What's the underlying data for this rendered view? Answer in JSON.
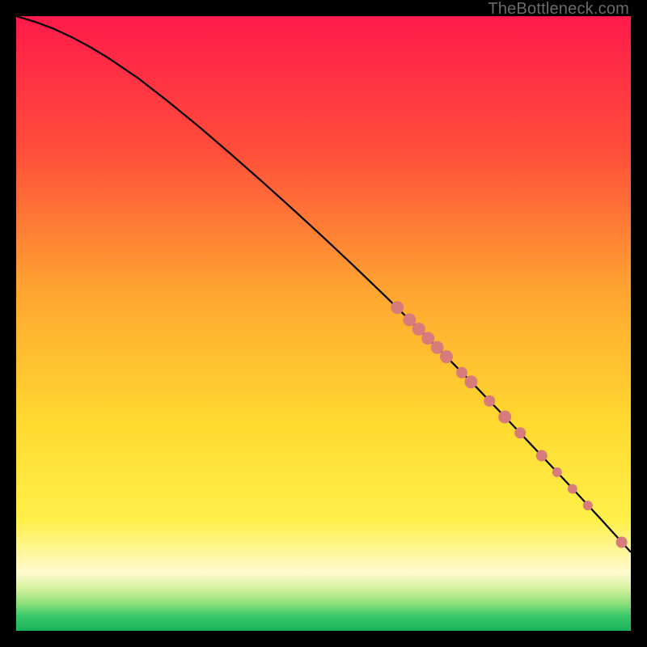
{
  "watermark": "TheBottleneck.com",
  "chart_data": {
    "type": "line",
    "title": "",
    "xlabel": "",
    "ylabel": "",
    "xlim": [
      0,
      100
    ],
    "ylim": [
      0,
      100
    ],
    "grid": false,
    "gradient_stops": [
      {
        "offset": 0.0,
        "color": "#ff1a4b"
      },
      {
        "offset": 0.22,
        "color": "#ff4e3a"
      },
      {
        "offset": 0.45,
        "color": "#ffa631"
      },
      {
        "offset": 0.66,
        "color": "#ffd92f"
      },
      {
        "offset": 0.82,
        "color": "#fff049"
      },
      {
        "offset": 0.905,
        "color": "#fffacf"
      },
      {
        "offset": 0.93,
        "color": "#d7f2a0"
      },
      {
        "offset": 0.955,
        "color": "#8fe07a"
      },
      {
        "offset": 0.975,
        "color": "#3bc96a"
      },
      {
        "offset": 1.0,
        "color": "#18b25b"
      }
    ],
    "series": [
      {
        "name": "curve",
        "type": "line",
        "color": "#000000",
        "x": [
          0,
          3,
          6,
          9,
          12,
          15,
          20,
          25,
          30,
          35,
          40,
          45,
          50,
          55,
          60,
          65,
          70,
          75,
          80,
          85,
          90,
          95,
          100
        ],
        "y": [
          100,
          99.1,
          98.0,
          96.6,
          95.0,
          93.2,
          89.8,
          85.9,
          81.8,
          77.5,
          73.1,
          68.6,
          64.0,
          59.3,
          54.5,
          49.6,
          44.6,
          39.5,
          34.3,
          29.0,
          23.7,
          18.3,
          12.8
        ]
      },
      {
        "name": "points",
        "type": "scatter",
        "color": "#d77b7b",
        "x": [
          62,
          64,
          65.5,
          67,
          68.5,
          70,
          72.5,
          74,
          77,
          79.5,
          82,
          85.5,
          88,
          90.5,
          93,
          98.5
        ],
        "y": [
          52.6,
          50.6,
          49.1,
          47.6,
          46.1,
          44.6,
          42.0,
          40.5,
          37.4,
          34.8,
          32.2,
          28.5,
          25.8,
          23.1,
          20.4,
          14.4
        ],
        "radius": [
          8,
          8,
          8,
          8,
          8,
          8,
          7,
          8,
          7,
          8,
          7,
          7,
          6,
          6,
          6,
          7
        ]
      }
    ]
  }
}
